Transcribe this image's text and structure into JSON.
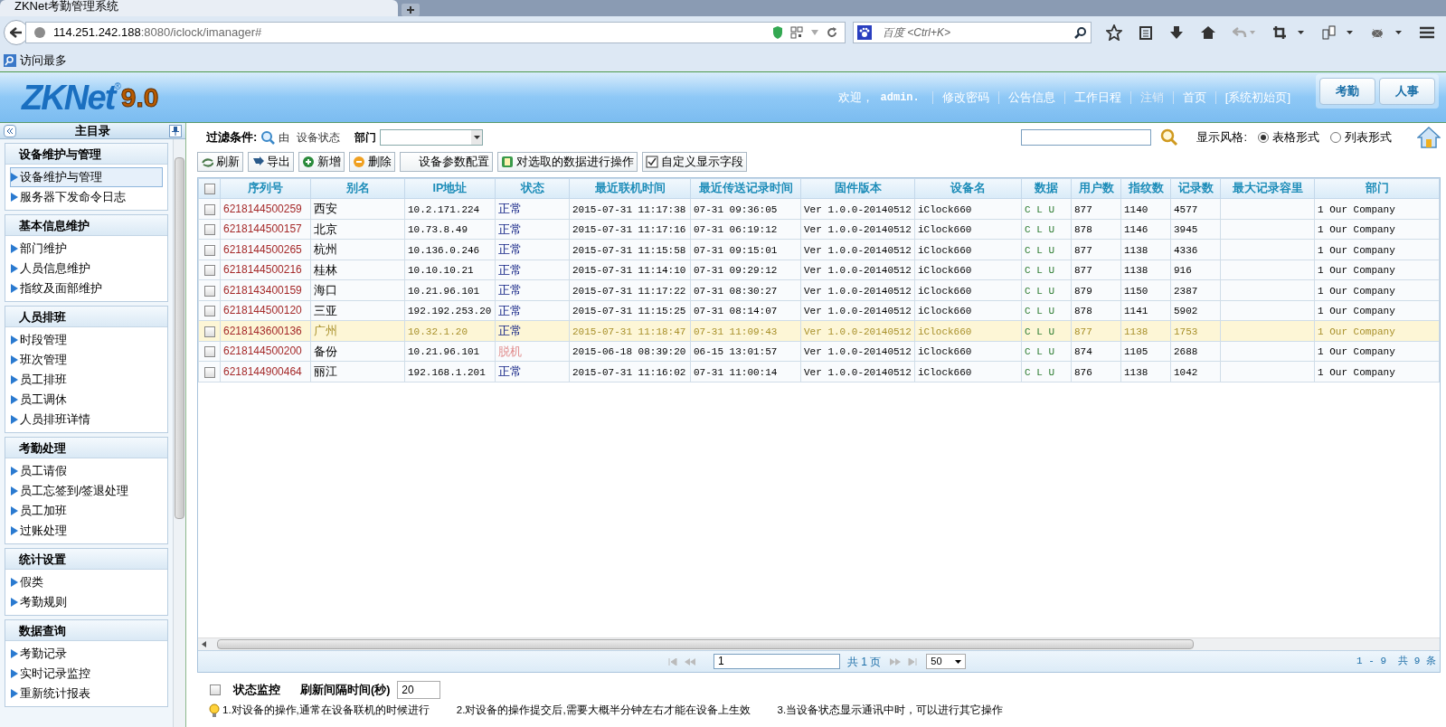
{
  "browser": {
    "tab_title": "ZKNet考勤管理系统",
    "url_host": "114.251.242.188",
    "url_rest": ":8080/iclock/imanager#",
    "search_placeholder": "百度 <Ctrl+K>",
    "bookmark": "访问最多"
  },
  "header": {
    "logo_text": "ZKNet",
    "logo_mark": "®",
    "logo_version": "9.0",
    "welcome": "欢迎，",
    "user": "admin.",
    "links": [
      "修改密码",
      "公告信息",
      "工作日程",
      "注销",
      "首页",
      "[系统初始页]"
    ],
    "modules": [
      "考勤",
      "人事"
    ]
  },
  "sidebar": {
    "title": "主目录",
    "groups": [
      {
        "title": "设备维护与管理",
        "items": [
          {
            "label": "设备维护与管理",
            "selected": true
          },
          {
            "label": "服务器下发命令日志",
            "selected": false
          }
        ]
      },
      {
        "title": "基本信息维护",
        "items": [
          {
            "label": "部门维护",
            "selected": false
          },
          {
            "label": "人员信息维护",
            "selected": false
          },
          {
            "label": "指纹及面部维护",
            "selected": false
          }
        ]
      },
      {
        "title": "人员排班",
        "items": [
          {
            "label": "时段管理",
            "selected": false
          },
          {
            "label": "班次管理",
            "selected": false
          },
          {
            "label": "员工排班",
            "selected": false
          },
          {
            "label": "员工调休",
            "selected": false
          },
          {
            "label": "人员排班详情",
            "selected": false
          }
        ]
      },
      {
        "title": "考勤处理",
        "items": [
          {
            "label": "员工请假",
            "selected": false
          },
          {
            "label": "员工忘签到/签退处理",
            "selected": false
          },
          {
            "label": "员工加班",
            "selected": false
          },
          {
            "label": "过账处理",
            "selected": false
          }
        ]
      },
      {
        "title": "统计设置",
        "items": [
          {
            "label": "假类",
            "selected": false
          },
          {
            "label": "考勤规则",
            "selected": false
          }
        ]
      },
      {
        "title": "数据查询",
        "items": [
          {
            "label": "考勤记录",
            "selected": false
          },
          {
            "label": "实时记录监控",
            "selected": false
          },
          {
            "label": "重新统计报表",
            "selected": false
          }
        ]
      }
    ]
  },
  "filter": {
    "label": "过滤条件:",
    "by": "由",
    "field": "设备状态",
    "dept_label": "部门",
    "style_label": "显示风格:",
    "styles": [
      {
        "label": "表格形式",
        "selected": true
      },
      {
        "label": "列表形式",
        "selected": false
      }
    ]
  },
  "toolbar": [
    {
      "kind": "refresh",
      "label": "刷新"
    },
    {
      "kind": "export",
      "label": "导出"
    },
    {
      "kind": "add",
      "label": "新增"
    },
    {
      "kind": "delete",
      "label": "删除"
    },
    {
      "kind": "plain",
      "label": "设备参数配置"
    },
    {
      "kind": "batch",
      "label": "对选取的数据进行操作"
    },
    {
      "kind": "checkbox",
      "label": "自定义显示字段"
    }
  ],
  "table": {
    "all_checked": false,
    "columns": [
      "序列号",
      "别名",
      "IP地址",
      "状态",
      "最近联机时间",
      "最近传送记录时间",
      "固件版本",
      "设备名",
      "数据",
      "用户数",
      "指纹数",
      "记录数",
      "最大记录容里",
      "部门"
    ],
    "rows": [
      {
        "selected": false,
        "checked": false,
        "serial": "6218144500259",
        "alias": "西安",
        "ip": "10.2.171.224",
        "status": "正常",
        "online": true,
        "last_online": "2015-07-31 11:17:38",
        "last_transfer": "07-31 09:36:05",
        "firmware": "Ver 1.0.0-20140512",
        "device": "iClock660",
        "data": "C L U",
        "users": "877",
        "fingerprints": "1140",
        "records": "4577",
        "department": "1 Our Company"
      },
      {
        "selected": false,
        "checked": false,
        "serial": "6218144500157",
        "alias": "北京",
        "ip": "10.73.8.49",
        "status": "正常",
        "online": true,
        "last_online": "2015-07-31 11:17:16",
        "last_transfer": "07-31 06:19:12",
        "firmware": "Ver 1.0.0-20140512",
        "device": "iClock660",
        "data": "C L U",
        "users": "878",
        "fingerprints": "1146",
        "records": "3945",
        "department": "1 Our Company"
      },
      {
        "selected": false,
        "checked": false,
        "serial": "6218144500265",
        "alias": "杭州",
        "ip": "10.136.0.246",
        "status": "正常",
        "online": true,
        "last_online": "2015-07-31 11:15:58",
        "last_transfer": "07-31 09:15:01",
        "firmware": "Ver 1.0.0-20140512",
        "device": "iClock660",
        "data": "C L U",
        "users": "877",
        "fingerprints": "1138",
        "records": "4336",
        "department": "1 Our Company"
      },
      {
        "selected": false,
        "checked": false,
        "serial": "6218144500216",
        "alias": "桂林",
        "ip": "10.10.10.21",
        "status": "正常",
        "online": true,
        "last_online": "2015-07-31 11:14:10",
        "last_transfer": "07-31 09:29:12",
        "firmware": "Ver 1.0.0-20140512",
        "device": "iClock660",
        "data": "C L U",
        "users": "877",
        "fingerprints": "1138",
        "records": "916",
        "department": "1 Our Company"
      },
      {
        "selected": false,
        "checked": false,
        "serial": "6218143400159",
        "alias": "海口",
        "ip": "10.21.96.101",
        "status": "正常",
        "online": true,
        "last_online": "2015-07-31 11:17:22",
        "last_transfer": "07-31 08:30:27",
        "firmware": "Ver 1.0.0-20140512",
        "device": "iClock660",
        "data": "C L U",
        "users": "879",
        "fingerprints": "1150",
        "records": "2387",
        "department": "1 Our Company"
      },
      {
        "selected": false,
        "checked": false,
        "serial": "6218144500120",
        "alias": "三亚",
        "ip": "192.192.253.20",
        "status": "正常",
        "online": true,
        "last_online": "2015-07-31 11:15:25",
        "last_transfer": "07-31 08:14:07",
        "firmware": "Ver 1.0.0-20140512",
        "device": "iClock660",
        "data": "C L U",
        "users": "878",
        "fingerprints": "1141",
        "records": "5902",
        "department": "1 Our Company"
      },
      {
        "selected": true,
        "checked": false,
        "serial": "6218143600136",
        "alias": "广州",
        "ip": "10.32.1.20",
        "status": "正常",
        "online": true,
        "last_online": "2015-07-31 11:18:47",
        "last_transfer": "07-31 11:09:43",
        "firmware": "Ver 1.0.0-20140512",
        "device": "iClock660",
        "data": "C L U",
        "users": "877",
        "fingerprints": "1138",
        "records": "1753",
        "department": "1 Our Company"
      },
      {
        "selected": false,
        "checked": false,
        "serial": "6218144500200",
        "alias": "备份",
        "ip": "10.21.96.101",
        "status": "脱机",
        "online": false,
        "last_online": "2015-06-18 08:39:20",
        "last_transfer": "06-15 13:01:57",
        "firmware": "Ver 1.0.0-20140512",
        "device": "iClock660",
        "data": "C L U",
        "users": "874",
        "fingerprints": "1105",
        "records": "2688",
        "department": "1 Our Company"
      },
      {
        "selected": false,
        "checked": false,
        "serial": "6218144900464",
        "alias": "丽江",
        "ip": "192.168.1.201",
        "status": "正常",
        "online": true,
        "last_online": "2015-07-31 11:16:02",
        "last_transfer": "07-31 11:00:14",
        "firmware": "Ver 1.0.0-20140512",
        "device": "iClock660",
        "data": "C L U",
        "users": "876",
        "fingerprints": "1138",
        "records": "1042",
        "department": "1 Our Company"
      }
    ]
  },
  "pager": {
    "page": "1",
    "total_pages": "共 1 页",
    "page_size": "50",
    "summary": "1 - 9  共 9 条"
  },
  "monitor": {
    "label": "状态监控",
    "checked": false,
    "interval_label": "刷新间隔时间(秒)",
    "interval": "20"
  },
  "tips": [
    "1.对设备的操作,通常在设备联机的时候进行",
    "2.对设备的操作提交后,需要大概半分钟左右才能在设备上生效",
    "3.当设备状态显示通讯中时，可以进行其它操作"
  ]
}
